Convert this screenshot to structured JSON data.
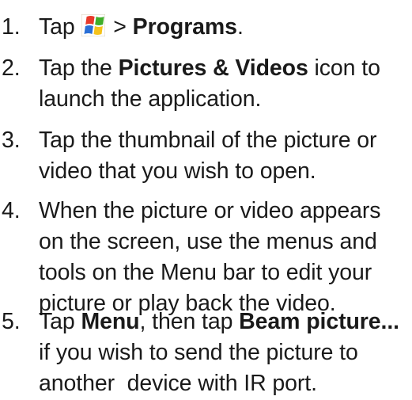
{
  "steps": [
    {
      "number": "1.",
      "lines": [
        [
          {
            "text": "Tap "
          },
          {
            "icon": "windows-start-icon"
          },
          {
            "text": " > "
          },
          {
            "text": "Programs",
            "bold": true
          },
          {
            "text": "."
          }
        ]
      ]
    },
    {
      "number": "2.",
      "lines": [
        [
          {
            "text": "Tap the "
          },
          {
            "text": "Pictures & Videos",
            "bold": true
          },
          {
            "text": " icon to"
          }
        ],
        [
          {
            "text": "launch the application."
          }
        ]
      ]
    },
    {
      "number": "3.",
      "lines": [
        [
          {
            "text": "Tap the thumbnail of the picture or"
          }
        ],
        [
          {
            "text": "video that you wish to open."
          }
        ]
      ]
    },
    {
      "number": "4.",
      "lines": [
        [
          {
            "text": "When the picture or video appears"
          }
        ],
        [
          {
            "text": "on the screen, use the menus and"
          }
        ],
        [
          {
            "text": "tools on the Menu bar to edit your"
          }
        ],
        [
          {
            "text": "picture or play back the video."
          }
        ]
      ]
    },
    {
      "number": "5.",
      "lines": [
        [
          {
            "text": "Tap "
          },
          {
            "text": "Menu",
            "bold": true
          },
          {
            "text": ", then tap "
          },
          {
            "text": "Beam picture...",
            "bold": true
          }
        ],
        [
          {
            "text": "if you wish to send the picture to"
          }
        ],
        [
          {
            "text": "another  device with IR port."
          }
        ]
      ]
    }
  ],
  "colors": {
    "text": "#1a1a1a",
    "background": "#ffffff"
  }
}
